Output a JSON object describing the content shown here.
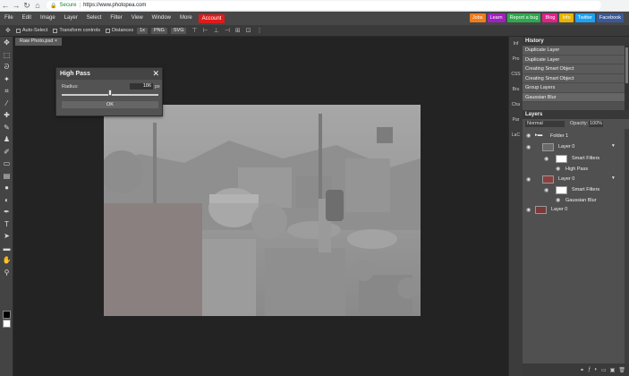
{
  "browser": {
    "secure_label": "Secure",
    "url": "https://www.photopea.com"
  },
  "menu": {
    "items": [
      "File",
      "Edit",
      "Image",
      "Layer",
      "Select",
      "Filter",
      "View",
      "Window",
      "More"
    ],
    "account": "Account"
  },
  "top_buttons": [
    {
      "label": "Jobs",
      "color": "#f07c1a"
    },
    {
      "label": "Learn",
      "color": "#a020c0"
    },
    {
      "label": "Report a bug",
      "color": "#2fa84f"
    },
    {
      "label": "Blog",
      "color": "#e0218a"
    },
    {
      "label": "Info",
      "color": "#e8b400"
    },
    {
      "label": "Twitter",
      "color": "#1da1f2"
    },
    {
      "label": "Facebook",
      "color": "#3b5998"
    }
  ],
  "options_bar": {
    "auto_select": "Auto-Select",
    "transform_controls": "Transform controls",
    "distances": "Distances",
    "zoom_value": "1x",
    "png": "PNG",
    "svg": "SVG"
  },
  "document": {
    "tab_label": "Raw Photo.psd"
  },
  "dialog": {
    "title": "High Pass",
    "radius_label": "Radius:",
    "radius_value": "186",
    "radius_unit": "px",
    "ok_label": "OK",
    "radius_fraction": 0.5
  },
  "icon_column": [
    "Inf",
    "Pro",
    "CSS",
    "Bru",
    "Cha",
    "Par",
    "LaC"
  ],
  "history": {
    "title": "History",
    "items": [
      "Duplicate Layer",
      "Duplicate Layer",
      "Creating Smart Object",
      "Creating Smart Object",
      "Group Layers",
      "Gaussian Blur"
    ]
  },
  "layers": {
    "title": "Layers",
    "blend_mode": "Normal",
    "opacity_label": "Opacity:",
    "opacity_value": "100%",
    "folder": "Folder 1",
    "layer_a": "Layer 0",
    "smart_filters_a": "Smart Filters",
    "filter_a": "High Pass",
    "layer_b": "Layer 0",
    "smart_filters_b": "Smart Filters",
    "filter_b": "Gaussian Blur",
    "layer_c": "Layer 0"
  }
}
